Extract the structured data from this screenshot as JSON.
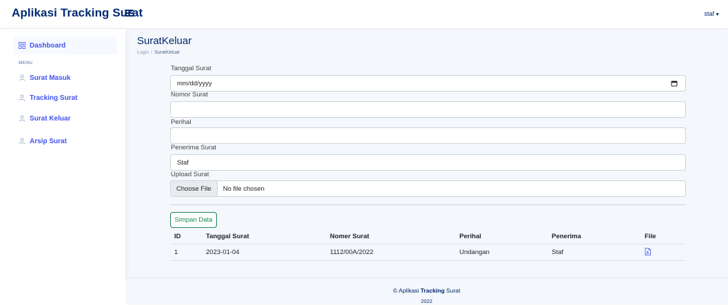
{
  "header": {
    "brand": "Aplikasi Tracking Surat",
    "user": "staf"
  },
  "sidebar": {
    "dashboard": "Dashboard",
    "heading": "MENU",
    "items": [
      {
        "label": "Surat Masuk"
      },
      {
        "label": "Tracking Surat"
      },
      {
        "label": "Surat Keluar"
      },
      {
        "label": "Arsip Surat"
      }
    ]
  },
  "page": {
    "title": "SuratKeluar",
    "breadcrumb": [
      "Login",
      "SuratKeluar"
    ]
  },
  "form": {
    "tanggal_label": "Tanggal Surat",
    "tanggal_value": "mm/dd/yyyy",
    "nomor_label": "Nomor Surat",
    "nomor_value": "",
    "perihal_label": "Perihal",
    "perihal_value": "",
    "penerima_label": "Penerima Surat",
    "penerima_value": "Staf",
    "upload_label": "Upload Surat",
    "choose_file": "Choose File",
    "no_file": "No file chosen",
    "save_label": "Simpan Data"
  },
  "table": {
    "headers": [
      "ID",
      "Tanggal Surat",
      "Nomer Surat",
      "Perihal",
      "Penerima",
      "File"
    ],
    "rows": [
      [
        "1",
        "2023-01-04",
        "1112/00A/2022",
        "Undangan",
        "Staf"
      ]
    ]
  },
  "footer": {
    "copy": "©",
    "prefix": "Aplikasi",
    "bold": "Tracking",
    "suffix": "Surat",
    "year": "2022"
  },
  "colors": {
    "brand": "#012970",
    "accent": "#4154f1",
    "success": "#198754"
  }
}
